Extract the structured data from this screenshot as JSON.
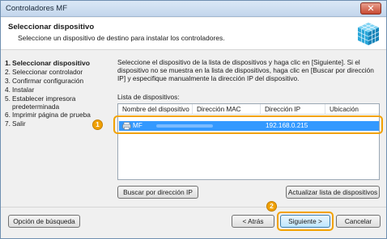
{
  "window": {
    "title": "Controladores MF"
  },
  "header": {
    "title": "Seleccionar dispositivo",
    "subtitle": "Seleccione un dispositivo de destino para instalar los controladores."
  },
  "steps": [
    {
      "num": "1.",
      "label": "Seleccionar dispositivo",
      "active": true
    },
    {
      "num": "2.",
      "label": "Seleccionar controlador"
    },
    {
      "num": "3.",
      "label": "Confirmar configuración"
    },
    {
      "num": "4.",
      "label": "Instalar"
    },
    {
      "num": "5.",
      "label": "Establecer impresora predeterminada"
    },
    {
      "num": "6.",
      "label": "Imprimir página de prueba"
    },
    {
      "num": "7.",
      "label": "Salir"
    }
  ],
  "main": {
    "instruction": "Seleccione el dispositivo de la lista de dispositivos y haga clic en [Siguiente]. Si el dispositivo no se muestra en la lista de dispositivos, haga clic en [Buscar por dirección IP] y especifique manualmente la dirección IP del dispositivo.",
    "list_label": "Lista de dispositivos:",
    "columns": [
      "Nombre del dispositivo",
      "Dirección MAC",
      "Dirección IP",
      "Ubicación"
    ],
    "rows": [
      {
        "name": "MF",
        "mac": "",
        "ip": "192.168.0.215",
        "location": ""
      }
    ],
    "search_ip_button": "Buscar por dirección IP",
    "refresh_button": "Actualizar lista de dispositivos"
  },
  "footer": {
    "search_option_button": "Opción de búsqueda",
    "back_button": "< Atrás",
    "next_button": "Siguiente >",
    "cancel_button": "Cancelar"
  },
  "callouts": {
    "one": "1",
    "two": "2"
  },
  "colors": {
    "selection": "#3399ff",
    "callout": "#f0a000"
  }
}
